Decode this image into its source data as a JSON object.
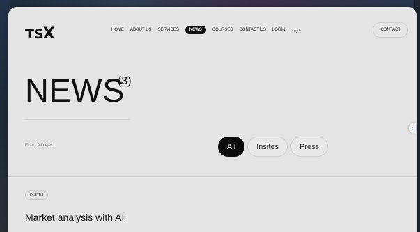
{
  "logo": {
    "text_main": "TS",
    "text_x": "X"
  },
  "nav": {
    "items": [
      {
        "label": "HOME"
      },
      {
        "label": "ABOUT US"
      },
      {
        "label": "SERVICES"
      },
      {
        "label": "NEWS",
        "active": true
      },
      {
        "label": "COURSES"
      },
      {
        "label": "CONTACT US"
      },
      {
        "label": "LOGIN"
      },
      {
        "label": "عربية"
      }
    ]
  },
  "header": {
    "contact_label": "CONTACT"
  },
  "hero": {
    "title": "NEWS",
    "count": "(3)"
  },
  "filter": {
    "label": "Filter",
    "value": "All news"
  },
  "tabs": [
    {
      "label": "All",
      "active": true
    },
    {
      "label": "Insites"
    },
    {
      "label": "Press"
    }
  ],
  "article": {
    "tag": "INSITES",
    "title": "Market analysis with AI"
  },
  "side_handle": {
    "icon": "chevron-left-icon",
    "glyph": "‹"
  },
  "colors": {
    "card_bg": "#e4e4e4",
    "active_bg": "#0d0d0d",
    "accent": "#3d7bd6"
  }
}
